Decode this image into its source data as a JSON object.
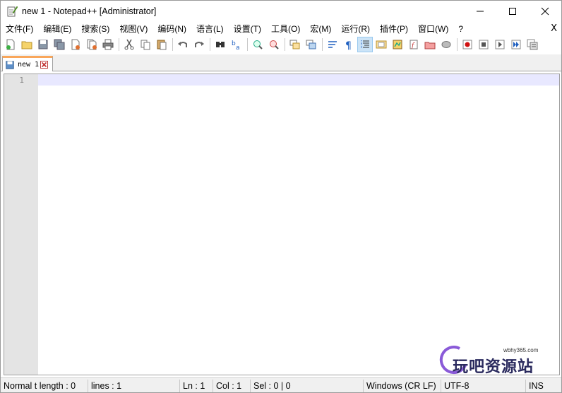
{
  "window": {
    "title": "new 1 - Notepad++ [Administrator]",
    "controls": {
      "minimize": "—",
      "maximize": "☐",
      "close": "✕"
    }
  },
  "menu": {
    "items": [
      "文件(F)",
      "编辑(E)",
      "搜索(S)",
      "视图(V)",
      "编码(N)",
      "语言(L)",
      "设置(T)",
      "工具(O)",
      "宏(M)",
      "运行(R)",
      "插件(P)",
      "窗口(W)",
      "?"
    ],
    "close_label": "X"
  },
  "toolbar": {
    "buttons": [
      "new-file-icon",
      "open-file-icon",
      "save-icon",
      "save-all-icon",
      "close-icon",
      "close-all-icon",
      "print-icon",
      "cut-icon",
      "copy-icon",
      "paste-icon",
      "undo-icon",
      "redo-icon",
      "find-icon",
      "replace-icon",
      "zoom-in-icon",
      "zoom-out-icon",
      "sync-vertical-icon",
      "sync-horizontal-icon",
      "word-wrap-icon",
      "show-all-characters-icon",
      "indent-guide-icon",
      "user-defined-language-icon",
      "document-map-icon",
      "function-list-icon",
      "folder-as-workspace-icon",
      "monitoring-icon",
      "record-macro-icon",
      "stop-macro-icon",
      "play-macro-icon",
      "run-macro-multiple-icon",
      "save-macro-icon"
    ],
    "active": "indent-guide-icon",
    "accent": "#cce4f7"
  },
  "tabs": [
    {
      "label": "new 1",
      "active": true,
      "accent": "#f9a65a"
    }
  ],
  "editor": {
    "line_numbers": [
      "1"
    ],
    "current_line_color": "#e8e8ff",
    "gutter_color": "#e4e4e4"
  },
  "statusbar": {
    "mode": "Normal t length : 0",
    "lines": "lines : 1",
    "ln": "Ln : 1",
    "col": "Col : 1",
    "sel": "Sel : 0 | 0",
    "eol": "Windows (CR LF)",
    "encoding": "UTF-8",
    "insert_mode": "INS"
  },
  "watermark": {
    "url": "wbhy365.com",
    "text": "玩吧资源站"
  }
}
